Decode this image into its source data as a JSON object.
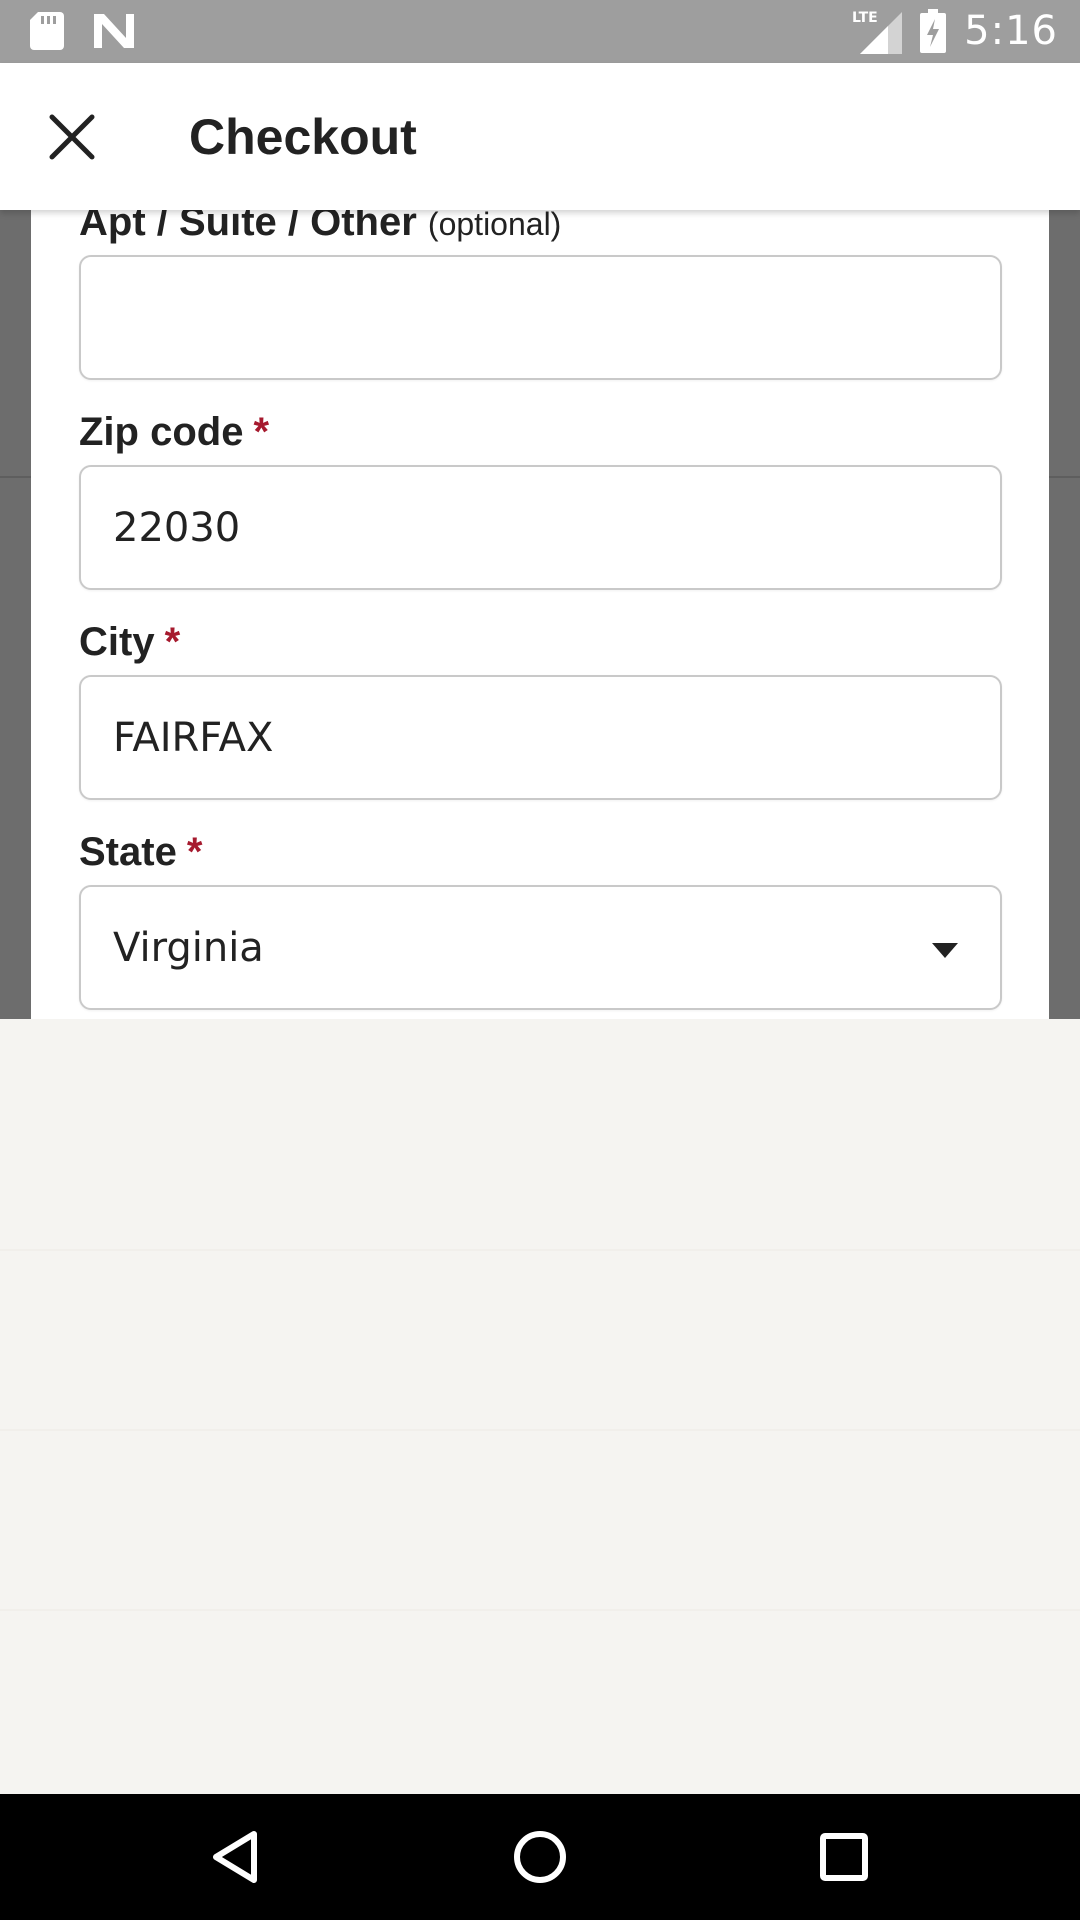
{
  "status_bar": {
    "time": "5:16",
    "network_label": "LTE",
    "icons": [
      "sd-card-icon",
      "n-notification-icon",
      "lte-signal-icon",
      "battery-charging-icon"
    ]
  },
  "header": {
    "title": "Checkout",
    "close_icon": "close-icon"
  },
  "form": {
    "apt": {
      "label": "Apt / Suite / Other",
      "optional": "(optional)",
      "value": ""
    },
    "zip": {
      "label": "Zip code",
      "required_mark": "*",
      "value": "22030"
    },
    "city": {
      "label": "City",
      "required_mark": "*",
      "value": "FAIRFAX"
    },
    "state": {
      "label": "State",
      "required_mark": "*",
      "value": "Virginia"
    }
  },
  "nav_bar": {
    "buttons": [
      "back-icon",
      "home-icon",
      "recents-icon"
    ]
  },
  "colors": {
    "required": "#a61a2e",
    "status_bar": "#9e9e9e",
    "dim_background": "#6d6d6d",
    "keyboard_background": "#f5f4f1"
  }
}
